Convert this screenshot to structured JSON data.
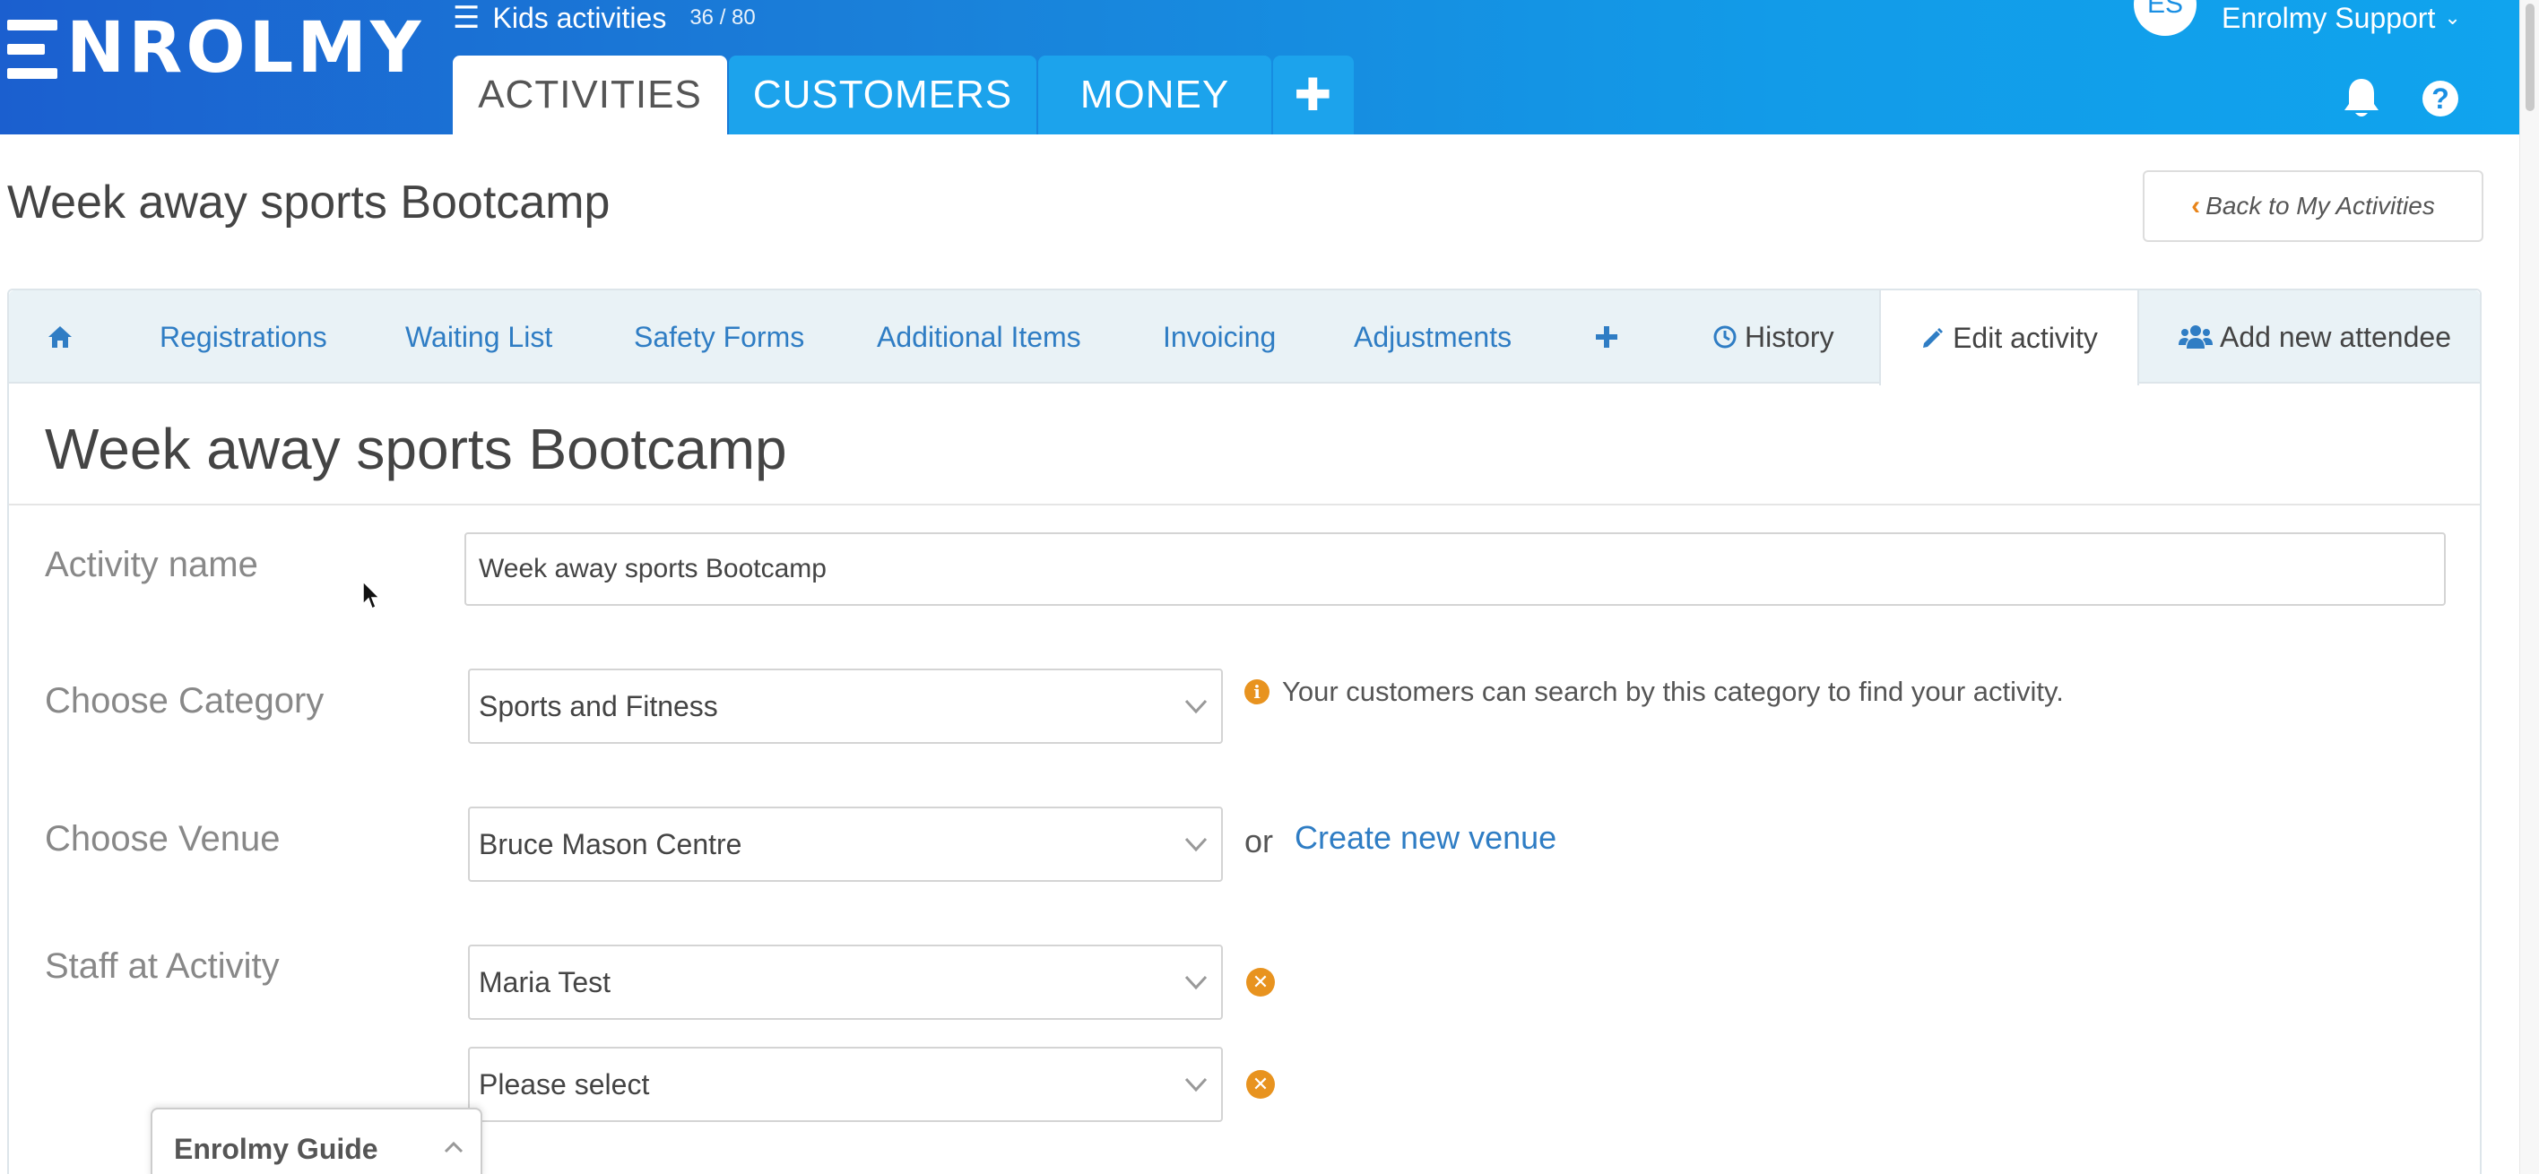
{
  "brand": {
    "logo_text": "NROLMY"
  },
  "header": {
    "org_name": "Kids activities",
    "org_count": "36 / 80",
    "tabs": [
      {
        "label": "ACTIVITIES",
        "active": true
      },
      {
        "label": "CUSTOMERS",
        "active": false
      },
      {
        "label": "MONEY",
        "active": false
      },
      {
        "label": "✚",
        "active": false
      }
    ],
    "user_initials": "ES",
    "user_name": "Enrolmy Support"
  },
  "page": {
    "title": "Week away sports Bootcamp",
    "back_button": "Back to My Activities"
  },
  "subnav": {
    "items": [
      {
        "label": ""
      },
      {
        "label": "Registrations"
      },
      {
        "label": "Waiting List"
      },
      {
        "label": "Safety Forms"
      },
      {
        "label": "Additional Items"
      },
      {
        "label": "Invoicing"
      },
      {
        "label": "Adjustments"
      },
      {
        "label": ""
      },
      {
        "label": "History"
      },
      {
        "label": "Edit activity",
        "active": true
      },
      {
        "label": "Add new attendee"
      }
    ]
  },
  "form": {
    "title": "Week away sports Bootcamp",
    "activity_name": {
      "label": "Activity name",
      "value": "Week away sports Bootcamp"
    },
    "category": {
      "label": "Choose Category",
      "value": "Sports and Fitness",
      "hint": "Your customers can search by this category to find your activity."
    },
    "venue": {
      "label": "Choose Venue",
      "value": "Bruce Mason Centre",
      "or_text": "or",
      "create_link": "Create new venue"
    },
    "staff": {
      "label": "Staff at Activity",
      "selections": [
        "Maria Test",
        "Please select"
      ]
    }
  },
  "guide": {
    "title": "Enrolmy Guide"
  },
  "colors": {
    "brand_blue": "#1a80d9",
    "link_blue": "#2f7dc4",
    "accent_orange": "#e8931f"
  }
}
